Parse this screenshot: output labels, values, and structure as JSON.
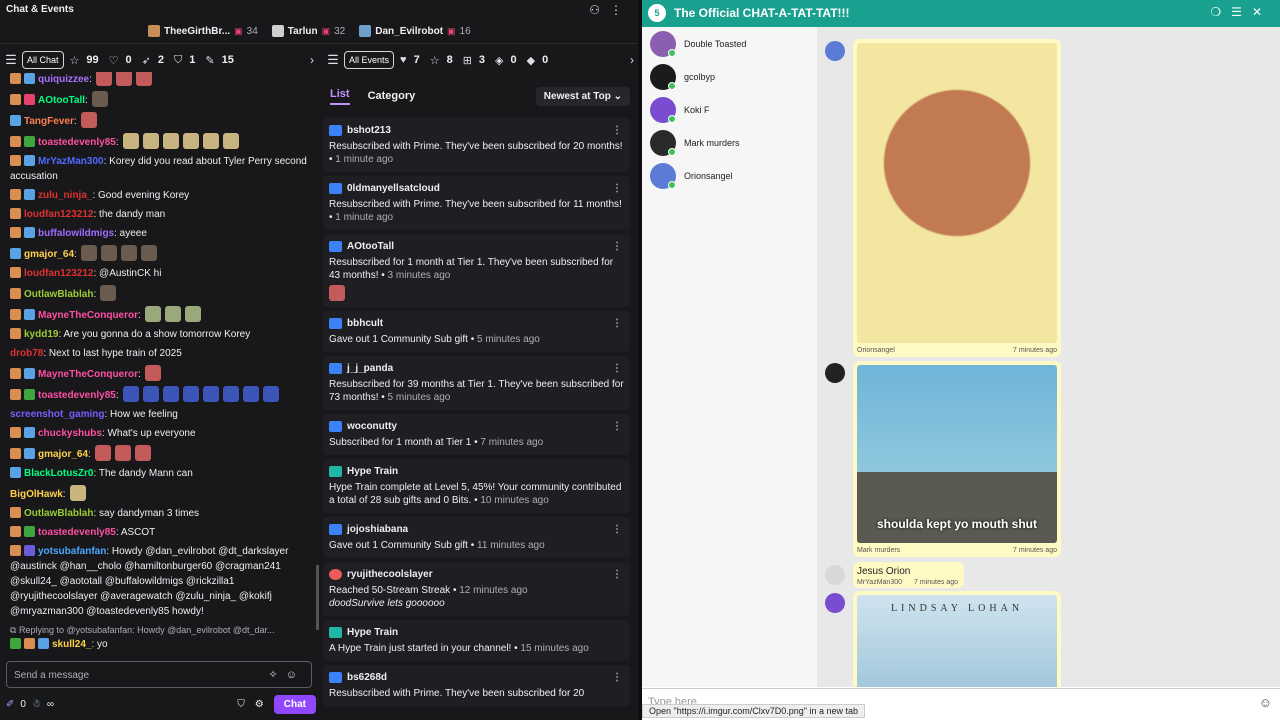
{
  "header": {
    "title": "Chat & Events",
    "icons": [
      "user-settings-icon",
      "more-icon"
    ]
  },
  "leaderboard": [
    {
      "name": "TheeGirthBr...",
      "count": "34"
    },
    {
      "name": "Tarlun",
      "count": "32"
    },
    {
      "name": "Dan_Evilrobot",
      "count": "16"
    }
  ],
  "chat_filters": {
    "all": "All Chat",
    "items": [
      {
        "icon": "star-icon",
        "count": "99"
      },
      {
        "icon": "heart-icon",
        "count": "0"
      },
      {
        "icon": "rocket-icon",
        "count": "2"
      },
      {
        "icon": "shield-icon",
        "count": "1"
      },
      {
        "icon": "pin-icon",
        "count": "15"
      }
    ]
  },
  "event_filters": {
    "all": "All Events",
    "items": [
      {
        "icon": "heart-icon",
        "count": "7"
      },
      {
        "icon": "star-icon",
        "count": "8"
      },
      {
        "icon": "gift-icon",
        "count": "3"
      },
      {
        "icon": "drop-icon",
        "count": "0"
      },
      {
        "icon": "bits-icon",
        "count": "0"
      }
    ]
  },
  "chat": [
    {
      "user": "quiquizzee",
      "color": "#a970ff",
      "text": ":"
    },
    {
      "user": "AOtooTall",
      "color": "#00ff7f",
      "text": ":"
    },
    {
      "user": "TangFever",
      "color": "#ff7f50",
      "text": ":"
    },
    {
      "user": "toastedevenly85",
      "color": "#ff4fa3",
      "text": ":"
    },
    {
      "user": "MrYazMan300",
      "color": "#4f6bff",
      "text": ": Korey did you read about Tyler Perry second accusation"
    },
    {
      "user": "zulu_ninja_",
      "color": "#e03030",
      "text": ": Good evening Korey"
    },
    {
      "user": "loudfan123212",
      "color": "#e03030",
      "text": ": the dandy man"
    },
    {
      "user": "buffalowildmigs",
      "color": "#9f6bff",
      "text": ": ayeee"
    },
    {
      "user": "gmajor_64",
      "color": "#ffd24a",
      "text": ":"
    },
    {
      "user": "loudfan123212",
      "color": "#e03030",
      "text": ": @AustinCK hi"
    },
    {
      "user": "OutlawBlablah",
      "color": "#9acd32",
      "text": ":"
    },
    {
      "user": "MayneTheConqueror",
      "color": "#ff4fa3",
      "text": ":"
    },
    {
      "user": "kydd19",
      "color": "#9acd32",
      "text": ": Are you gonna do a show tomorrow Korey"
    },
    {
      "user": "drob78",
      "color": "#e03030",
      "text": ": Next to last hype train of 2025"
    },
    {
      "user": "MayneTheConqueror",
      "color": "#ff4fa3",
      "text": ":"
    },
    {
      "user": "toastedevenly85",
      "color": "#ff4fa3",
      "text": ":"
    },
    {
      "user": "screenshot_gaming",
      "color": "#7b5cff",
      "text": ": How we feeling"
    },
    {
      "user": "chuckyshubs",
      "color": "#ff4fa3",
      "text": ": What's up everyone"
    },
    {
      "user": "gmajor_64",
      "color": "#ffd24a",
      "text": ":"
    },
    {
      "user": "BlackLotusZr0",
      "color": "#00ff7f",
      "text": ": The dandy Mann can"
    },
    {
      "user": "BigOlHawk",
      "color": "#ffd24a",
      "text": ":"
    },
    {
      "user": "OutlawBlablah",
      "color": "#9acd32",
      "text": ": say dandyman 3 times"
    },
    {
      "user": "toastedevenly85",
      "color": "#ff4fa3",
      "text": ": ASCOT"
    },
    {
      "user": "yotsubafanfan",
      "color": "#4aa8ff",
      "text": ": Howdy @dan_evilrobot @dt_darkslayer @austinck @han__cholo @hamiltonburger60 @cragman241 @skull24_ @aototall @buffalowildmigs @rickzilla1 @ryujithecoolslayer @averagewatch @zulu_ninja_ @kokifj @mryazman300 @toastedevenly85 howdy!"
    }
  ],
  "reply": {
    "text": "Replying to @yotsubafanfan: Howdy @dan_evilrobot @dt_dar...",
    "user": "skull24_",
    "msg": ": yo"
  },
  "chat_input": {
    "placeholder": "Send a message"
  },
  "bottombar": {
    "points": "0",
    "infinity": "∞",
    "chat_button": "Chat"
  },
  "events_tabs": {
    "list": "List",
    "category": "Category",
    "sort": "Newest at Top"
  },
  "events": [
    {
      "icon": "prime-icon",
      "user": "bshot213",
      "body": "Resubscribed with Prime. They've been subscribed for 20 months!",
      "time": "1 minute ago"
    },
    {
      "icon": "prime-icon",
      "user": "0ldmanyellsatcloud",
      "body": "Resubscribed with Prime. They've been subscribed for 11 months!",
      "time": "1 minute ago"
    },
    {
      "icon": "prime-icon",
      "user": "AOtooTall",
      "body": "Resubscribed for 1 month at Tier 1. They've been subscribed for 43 months!",
      "time": "3 minutes ago"
    },
    {
      "icon": "gift-icon",
      "user": "bbhcult",
      "body": "Gave out 1 Community Sub gift",
      "time": "5 minutes ago"
    },
    {
      "icon": "star-icon",
      "user": "j_j_panda",
      "body": "Resubscribed for 39 months at Tier 1. They've been subscribed for 73 months!",
      "time": "5 minutes ago"
    },
    {
      "icon": "star-icon",
      "user": "woconutty",
      "body": "Subscribed for 1 month at Tier 1",
      "time": "7 minutes ago"
    },
    {
      "icon": "train-icon",
      "user": "Hype Train",
      "body": "Hype Train complete at Level 5, 45%! Your community contributed a total of 28 sub gifts and 0 Bits.",
      "time": "10 minutes ago"
    },
    {
      "icon": "gift-icon",
      "user": "jojoshiabana",
      "body": "Gave out 1 Community Sub gift",
      "time": "11 minutes ago"
    },
    {
      "icon": "streak-icon",
      "user": "ryujithecoolslayer",
      "body": "Reached 50-Stream Streak",
      "time": "12 minutes ago",
      "italic": "doodSurvive lets goooooo"
    },
    {
      "icon": "train-icon",
      "user": "Hype Train",
      "body": "A Hype Train just started in your channel!",
      "time": "15 minutes ago"
    },
    {
      "icon": "prime-icon",
      "user": "bs6268d",
      "body": "Resubscribed with Prime. They've been subscribed for 20",
      "time": ""
    }
  ],
  "right_panel": {
    "title": "The Official CHAT-A-TAT-TAT!!!",
    "badge": "5",
    "users": [
      {
        "name": "Double Toasted",
        "color": "#8a5fb0"
      },
      {
        "name": "gcolbyp",
        "color": "#1b1b1b"
      },
      {
        "name": "Koki F",
        "color": "#7a4ccf"
      },
      {
        "name": "Mark murders",
        "color": "#2a2a2a"
      },
      {
        "name": "Orionsangel",
        "color": "#5b7bd5"
      }
    ],
    "posts": [
      {
        "author": "Orionsangel",
        "time": "7 minutes ago"
      },
      {
        "author": "Mark murders",
        "time": "7 minutes ago",
        "caption": "shoulda kept yo mouth shut"
      },
      {
        "author": "MrYazMan300",
        "time": "7 minutes ago",
        "text": "Jesus Orion"
      },
      {
        "banner": "LINDSAY LOHAN"
      }
    ],
    "input_placeholder": "Type here",
    "status_url": "Open \"https://i.imgur.com/Clxv7D0.png\" in a new tab"
  }
}
